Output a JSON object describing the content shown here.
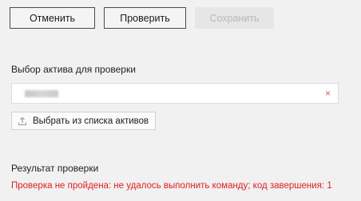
{
  "toolbar": {
    "cancel_label": "Отменить",
    "check_label": "Проверить",
    "save_label": "Сохранить"
  },
  "asset_section": {
    "title": "Выбор актива для проверки",
    "clear_icon": "×",
    "pick_button_label": "Выбрать из списка активов",
    "pick_icon": "upload-icon"
  },
  "result_section": {
    "title": "Результат проверки",
    "message": "Проверка не пройдена: не удалось выполнить команду; код завершения: 1",
    "message_color": "#e01f1f"
  }
}
